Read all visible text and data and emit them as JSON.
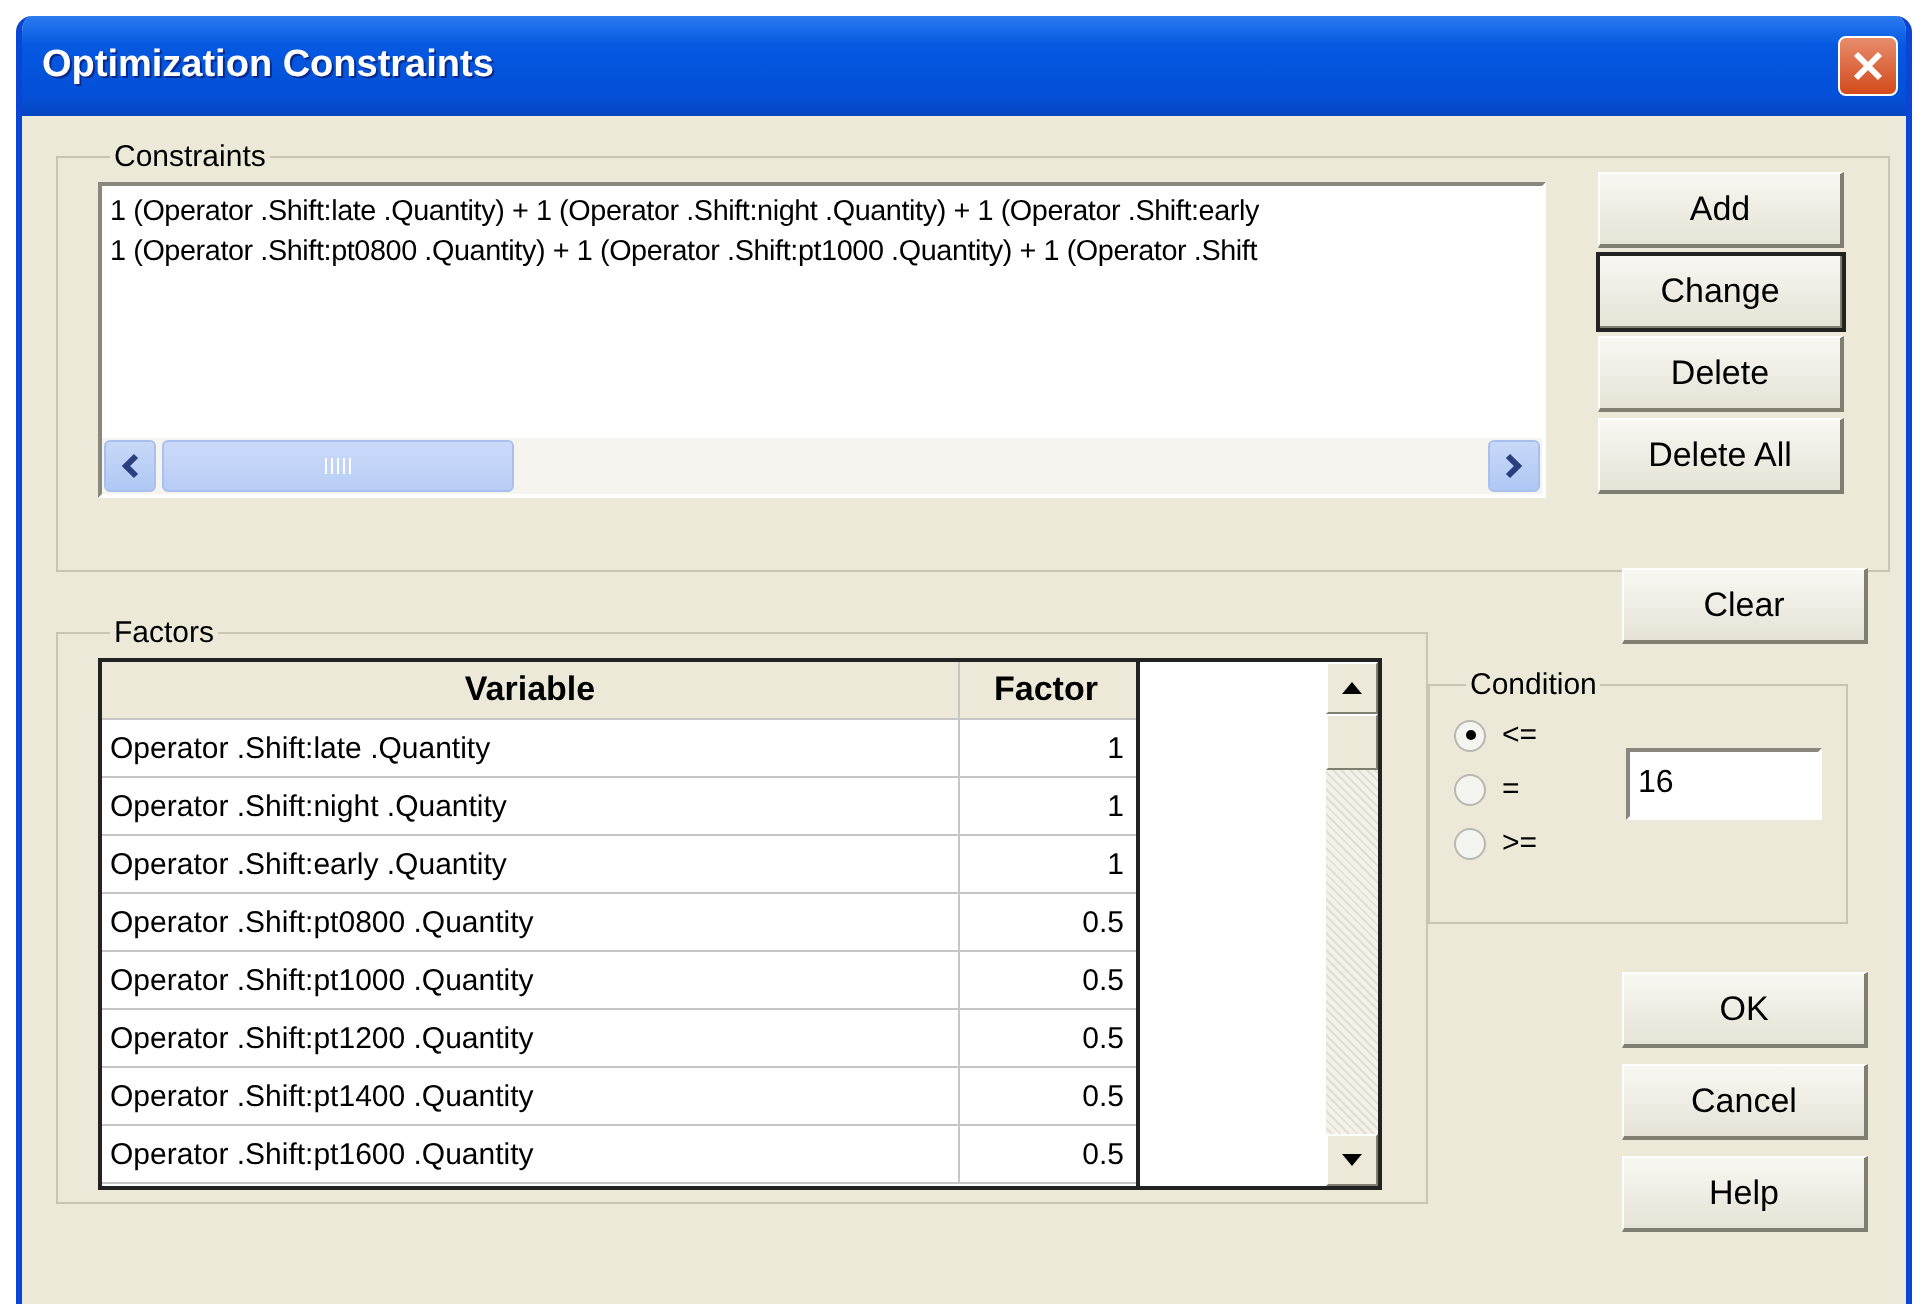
{
  "window": {
    "title": "Optimization Constraints"
  },
  "constraints": {
    "label": "Constraints",
    "lines": [
      "1 (Operator .Shift:late .Quantity) + 1 (Operator .Shift:night .Quantity) + 1 (Operator .Shift:early",
      "1 (Operator .Shift:pt0800 .Quantity) + 1 (Operator .Shift:pt1000 .Quantity) + 1 (Operator .Shift"
    ]
  },
  "constraint_buttons": [
    {
      "label": "Add",
      "focused": false
    },
    {
      "label": "Change",
      "focused": true
    },
    {
      "label": "Delete",
      "focused": false
    },
    {
      "label": "Delete All",
      "focused": false
    }
  ],
  "factors": {
    "label": "Factors",
    "columns": [
      "Variable",
      "Factor"
    ],
    "rows": [
      {
        "variable": "Operator .Shift:late .Quantity",
        "factor": "1"
      },
      {
        "variable": "Operator .Shift:night .Quantity",
        "factor": "1"
      },
      {
        "variable": "Operator .Shift:early .Quantity",
        "factor": "1"
      },
      {
        "variable": "Operator .Shift:pt0800 .Quantity",
        "factor": "0.5"
      },
      {
        "variable": "Operator .Shift:pt1000 .Quantity",
        "factor": "0.5"
      },
      {
        "variable": "Operator .Shift:pt1200 .Quantity",
        "factor": "0.5"
      },
      {
        "variable": "Operator .Shift:pt1400 .Quantity",
        "factor": "0.5"
      },
      {
        "variable": "Operator .Shift:pt1600 .Quantity",
        "factor": "0.5"
      }
    ]
  },
  "clear_button": "Clear",
  "condition": {
    "label": "Condition",
    "options": [
      {
        "label": "<=",
        "selected": true
      },
      {
        "label": "=",
        "selected": false
      },
      {
        "label": ">=",
        "selected": false
      }
    ],
    "value": "16"
  },
  "dialog_buttons": [
    "OK",
    "Cancel",
    "Help"
  ]
}
